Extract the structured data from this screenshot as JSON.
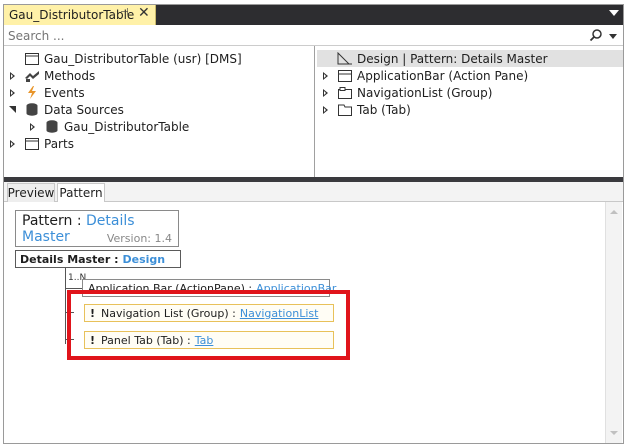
{
  "window": {
    "tab_title": "Gau_DistributorTable",
    "pin_glyph": "⊣",
    "close_glyph": "✕"
  },
  "search": {
    "placeholder": "Search ..."
  },
  "left_tree": [
    {
      "label": "Gau_DistributorTable (usr) [DMS]",
      "icon": "form-icon",
      "expander": "none",
      "indent": 0
    },
    {
      "label": "Methods",
      "icon": "methods-icon",
      "expander": "collapsed",
      "indent": 0
    },
    {
      "label": "Events",
      "icon": "events-icon",
      "expander": "collapsed",
      "indent": 0
    },
    {
      "label": "Data Sources",
      "icon": "database-icon",
      "expander": "expanded",
      "indent": 0
    },
    {
      "label": "Gau_DistributorTable",
      "icon": "database-icon",
      "expander": "collapsed",
      "indent": 1
    },
    {
      "label": "Parts",
      "icon": "parts-icon",
      "expander": "collapsed",
      "indent": 0
    }
  ],
  "right_tree": [
    {
      "label": "Design | Pattern: Details Master",
      "icon": "design-icon",
      "expander": "none",
      "selected": true
    },
    {
      "label": "ApplicationBar (Action Pane)",
      "icon": "actionpane-icon",
      "expander": "collapsed"
    },
    {
      "label": "NavigationList (Group)",
      "icon": "group-icon",
      "expander": "collapsed"
    },
    {
      "label": "Tab (Tab)",
      "icon": "tab-icon",
      "expander": "collapsed"
    }
  ],
  "lower_tabs": {
    "preview": "Preview",
    "pattern": "Pattern"
  },
  "pattern": {
    "label": "Pattern :",
    "name": "Details Master",
    "version": "Version: 1.4",
    "root_label": "Details Master :",
    "root_link": "Design",
    "multiplicity": "1..N",
    "nodes": [
      {
        "warn": false,
        "label": "Application Bar (ActionPane) :",
        "link": "ApplicationBar"
      },
      {
        "warn": true,
        "label": "Navigation List (Group) :",
        "link": "NavigationList"
      },
      {
        "warn": true,
        "label": "Panel Tab (Tab) :",
        "link": "Tab"
      }
    ],
    "warn_glyph": "!"
  },
  "colors": {
    "tab_active": "#fff1a8",
    "link": "#3c8fd8",
    "highlight": "#e0141b",
    "warn_border": "#e8c15a"
  }
}
